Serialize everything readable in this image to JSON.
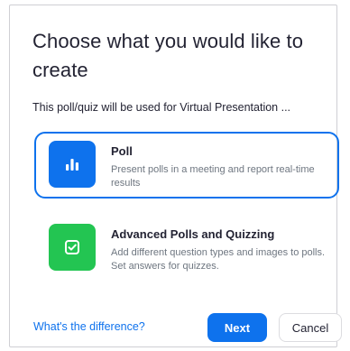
{
  "dialog": {
    "title": "Choose what you would like to create",
    "subtitle": "This poll/quiz will be used for Virtual Presentation ..."
  },
  "options": [
    {
      "title": "Poll",
      "description": "Present polls in a meeting and report real-time results",
      "icon": "bar-chart-icon",
      "color": "#0e72ed",
      "selected": true
    },
    {
      "title": "Advanced Polls and Quizzing",
      "description": "Add different question types and images to polls. Set answers for quizzes.",
      "icon": "checkbox-icon",
      "color": "#23c552",
      "selected": false
    }
  ],
  "footer": {
    "difference_link": "What's the difference?",
    "next_label": "Next",
    "cancel_label": "Cancel"
  },
  "colors": {
    "accent": "#0e72ed",
    "success": "#23c552",
    "text": "#232333",
    "muted": "#6e7680"
  }
}
